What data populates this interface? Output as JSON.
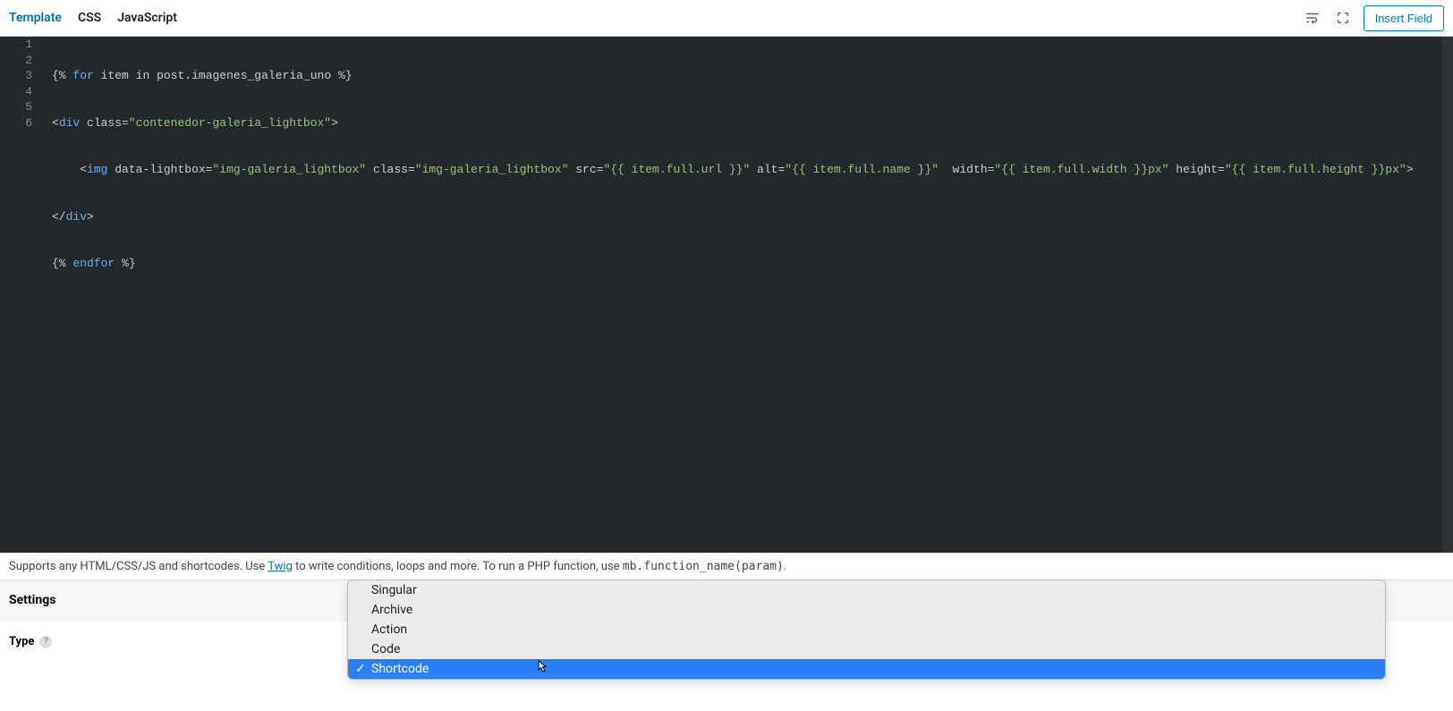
{
  "toolbar": {
    "tabs": [
      "Template",
      "CSS",
      "JavaScript"
    ],
    "active_tab_index": 0,
    "insert_label": "Insert Field"
  },
  "editor": {
    "line_count": 6,
    "code": {
      "l1_open": "{%",
      "l1_for": "for",
      "l1_item": "item",
      "l1_in": "in",
      "l1_expr": "post.imagenes_galeria_uno",
      "l1_close": "%}",
      "l2_open": "<",
      "l2_tag": "div",
      "l2_attr1": "class",
      "l2_eq": "=",
      "l2_val1": "\"contenedor-galeria_lightbox\"",
      "l2_end": ">",
      "l3_indent": "    ",
      "l3_open": "<",
      "l3_tag": "img",
      "l3_a1": "data-lightbox",
      "l3_v1": "\"img-galeria_lightbox\"",
      "l3_a2": "class",
      "l3_v2": "\"img-galeria_lightbox\"",
      "l3_a3": "src",
      "l3_v3": "\"{{ item.full.url }}\"",
      "l3_a4": "alt",
      "l3_v4": "\"{{ item.full.name }}\"",
      "l3_a5": "width",
      "l3_v5": "\"{{ item.full.width }}px\"",
      "l3_a6": "height",
      "l3_v6": "\"{{ item.full.height }}px\"",
      "l3_end": ">",
      "l4_open": "</",
      "l4_tag": "div",
      "l4_end": ">",
      "l5_open": "{%",
      "l5_endfor": "endfor",
      "l5_close": "%}"
    }
  },
  "help": {
    "prefix": "Supports any HTML/CSS/JS and shortcodes. Use ",
    "link": "Twig",
    "mid": " to write conditions, loops and more. To run a PHP function, use ",
    "code": "mb.function_name(param)",
    "end": "."
  },
  "settings": {
    "heading": "Settings",
    "type_label": "Type"
  },
  "dropdown": {
    "options": [
      "Singular",
      "Archive",
      "Action",
      "Code",
      "Shortcode"
    ],
    "selected_index": 4
  }
}
